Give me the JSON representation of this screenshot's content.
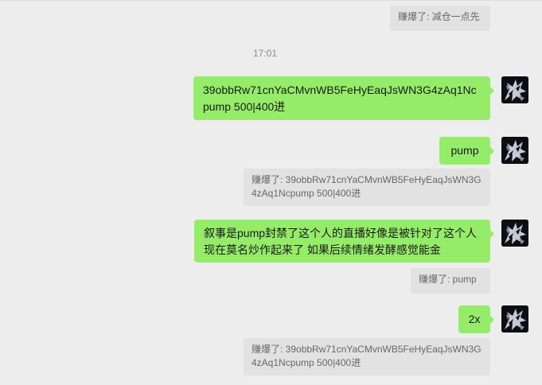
{
  "colors": {
    "background": "#ededed",
    "bubble_green": "#95ec69",
    "quote_bg": "#e2e2e2",
    "quote_text": "#676767"
  },
  "top_quote": "赚爆了: 减仓一点先",
  "timestamp": "17:01",
  "messages": [
    {
      "text": "39obbRw71cnYaCMvnWB5FeHyEaqJsWN3G4zAq1Ncpump 500|400进"
    },
    {
      "text": "pump",
      "quote": "赚爆了: 39obbRw71cnYaCMvnWB5FeHyEaqJsWN3G4zAq1Ncpump 500|400进"
    },
    {
      "text": "叙事是pump封禁了这个人的直播好像是被针对了这个人现在莫名炒作起来了 如果后续情绪发酵感觉能金",
      "quote": "赚爆了: pump"
    },
    {
      "text": "2x",
      "quote": "赚爆了: 39obbRw71cnYaCMvnWB5FeHyEaqJsWN3G4zAq1Ncpump 500|400进"
    }
  ],
  "avatar_icon": "dark-creature-avatar-icon"
}
